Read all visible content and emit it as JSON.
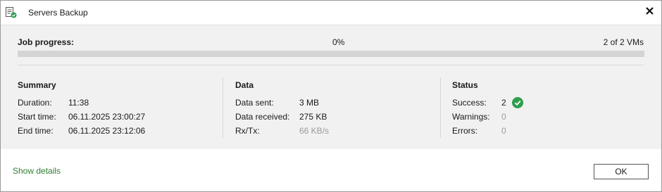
{
  "window": {
    "title": "Servers Backup",
    "icons": {
      "app": "backup-job-icon",
      "close": "close-icon"
    }
  },
  "progress": {
    "label": "Job progress:",
    "percent_text": "0%",
    "vms_text": "2 of 2 VMs",
    "fraction": 0
  },
  "summary": {
    "title": "Summary",
    "rows": [
      {
        "key": "Duration:",
        "value": "11:38"
      },
      {
        "key": "Start time:",
        "value": "06.11.2025 23:00:27"
      },
      {
        "key": "End time:",
        "value": "06.11.2025 23:12:06"
      }
    ]
  },
  "data": {
    "title": "Data",
    "rows": [
      {
        "key": "Data sent:",
        "value": "3 MB"
      },
      {
        "key": "Data received:",
        "value": "275 KB"
      },
      {
        "key": "Rx/Tx:",
        "value": "66 KB/s"
      }
    ]
  },
  "status": {
    "title": "Status",
    "rows": [
      {
        "key": "Success:",
        "value": "2",
        "icon": "success-check-icon"
      },
      {
        "key": "Warnings:",
        "value": "0"
      },
      {
        "key": "Errors:",
        "value": "0"
      }
    ]
  },
  "footer": {
    "show_details": "Show details",
    "ok_label": "OK"
  },
  "colors": {
    "accent_green": "#2e9e4f",
    "link_green": "#2e7d32",
    "panel_bg": "#f1f1f1",
    "track": "#d4d4d4"
  }
}
